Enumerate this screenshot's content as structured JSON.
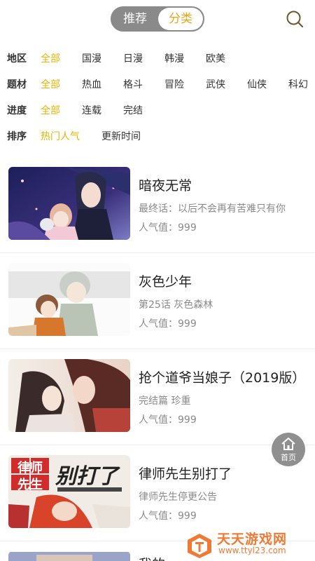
{
  "header": {
    "tab_recommend": "推荐",
    "tab_category": "分类",
    "search_icon": "search-icon"
  },
  "filters": {
    "region": {
      "title": "地区",
      "options": [
        "全部",
        "国漫",
        "日漫",
        "韩漫",
        "欧美"
      ],
      "active": "全部"
    },
    "genre": {
      "title": "题材",
      "options": [
        "全部",
        "热血",
        "格斗",
        "冒险",
        "武侠",
        "仙侠",
        "科幻"
      ],
      "active": "全部"
    },
    "progress": {
      "title": "进度",
      "options": [
        "全部",
        "连载",
        "完结"
      ],
      "active": "全部"
    },
    "sort": {
      "title": "排序",
      "options": [
        "热门人气",
        "更新时间"
      ],
      "active": "热门人气"
    }
  },
  "comics": [
    {
      "title": "暗夜无常",
      "subtitle": "最终话：以后不会再有苦难只有你",
      "popularity": "人气值：999"
    },
    {
      "title": "灰色少年",
      "subtitle": "第25话 灰色森林",
      "popularity": "人气值：999"
    },
    {
      "title": "抢个道爷当娘子（2019版）",
      "subtitle": "完结篇 珍重",
      "popularity": "人气值：999"
    },
    {
      "title": "律师先生别打了",
      "subtitle": "律师先生停更公告",
      "popularity": "人气值：999"
    },
    {
      "title": "我的",
      "subtitle": "",
      "popularity": ""
    }
  ],
  "cover_text": {
    "cover4_line1": "律师",
    "cover4_line2": "先生",
    "cover4_line3": "别打了"
  },
  "home_button": {
    "label": "首页",
    "icon": "home-icon"
  },
  "watermark": {
    "line1": "天天游戏网",
    "line2": "www.ttyl23.com"
  },
  "colors": {
    "accent": "#e8b400",
    "segment_bg": "#8a8a8a",
    "watermark": "#f07a35"
  }
}
